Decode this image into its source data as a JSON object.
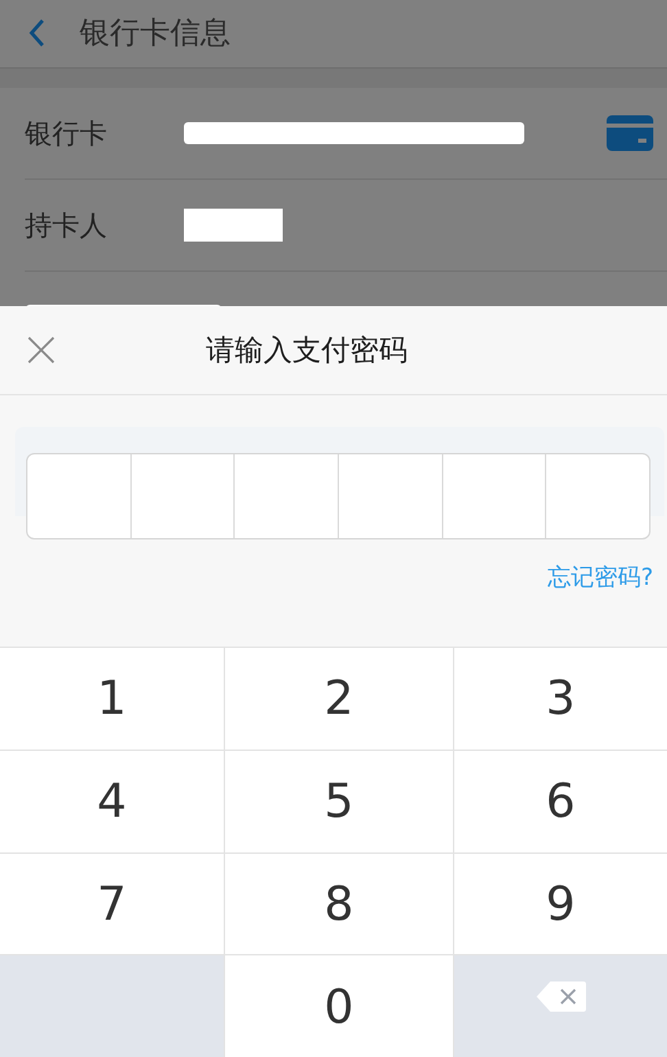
{
  "header": {
    "title": "银行卡信息"
  },
  "card_rows": [
    {
      "label": "银行卡",
      "kind": "card"
    },
    {
      "label": "持卡人",
      "kind": "plain"
    },
    {
      "kind": "partial"
    }
  ],
  "password_sheet": {
    "title": "请输入支付密码",
    "boxes": [
      {
        "filled": false
      },
      {
        "filled": false
      },
      {
        "filled": false
      },
      {
        "filled": false
      },
      {
        "filled": false
      },
      {
        "filled": false
      }
    ],
    "forgot_link": "忘记密码?"
  },
  "keypad": [
    {
      "kind": "digit",
      "label": "1"
    },
    {
      "kind": "digit",
      "label": "2"
    },
    {
      "kind": "digit",
      "label": "3"
    },
    {
      "kind": "digit",
      "label": "4"
    },
    {
      "kind": "digit",
      "label": "5"
    },
    {
      "kind": "digit",
      "label": "6"
    },
    {
      "kind": "digit",
      "label": "7"
    },
    {
      "kind": "digit",
      "label": "8"
    },
    {
      "kind": "digit",
      "label": "9"
    },
    {
      "kind": "blank"
    },
    {
      "kind": "digit",
      "label": "0"
    },
    {
      "kind": "delete"
    }
  ]
}
